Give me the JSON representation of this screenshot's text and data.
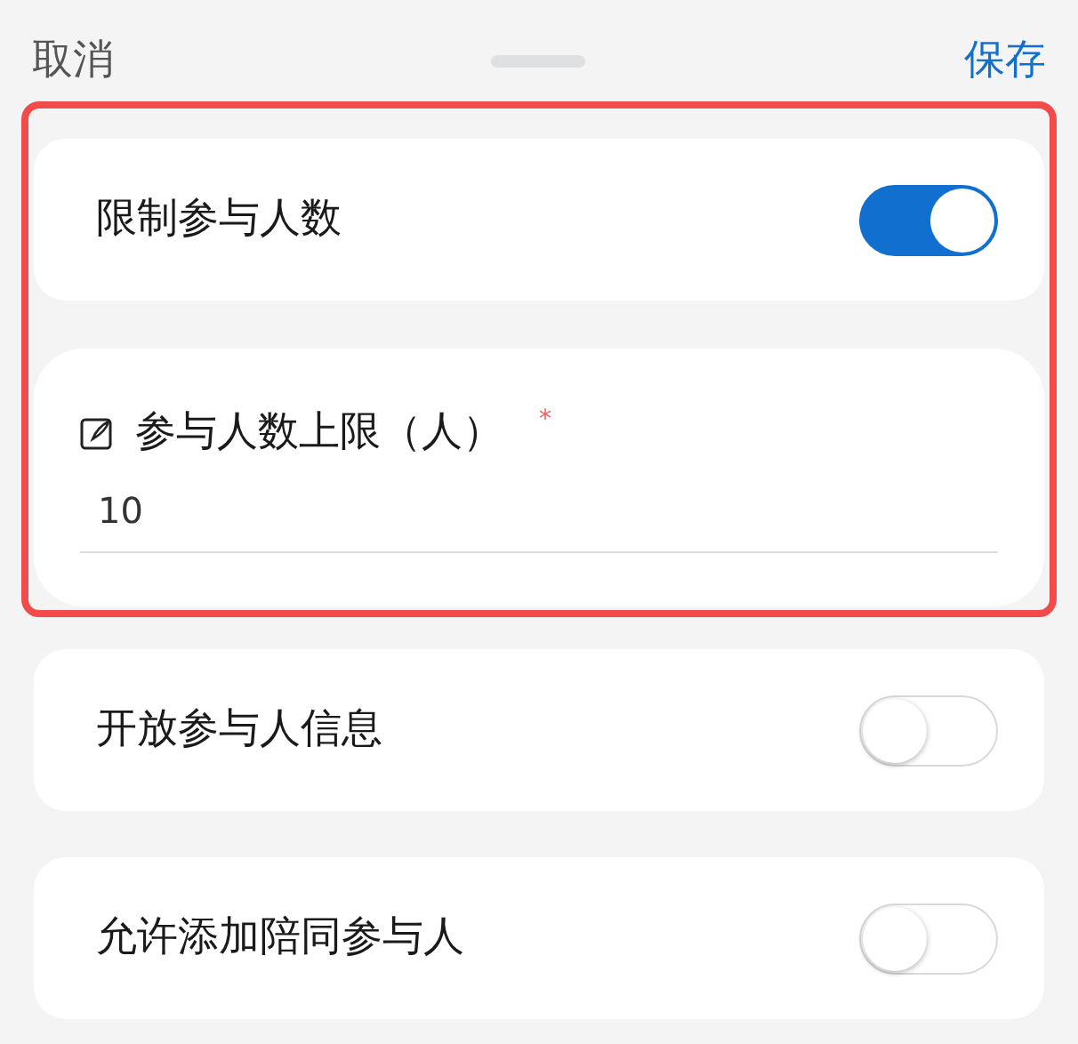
{
  "header": {
    "cancel": "取消",
    "save": "保存"
  },
  "highlighted_group": {
    "highlighted": true,
    "toggle": {
      "label": "限制参与人数",
      "on": true
    },
    "field": {
      "label": "参与人数上限（人）",
      "required_mark": "*",
      "value": "10"
    }
  },
  "toggles": [
    {
      "label": "开放参与人信息",
      "on": false
    },
    {
      "label": "允许添加陪同参与人",
      "on": false
    }
  ]
}
